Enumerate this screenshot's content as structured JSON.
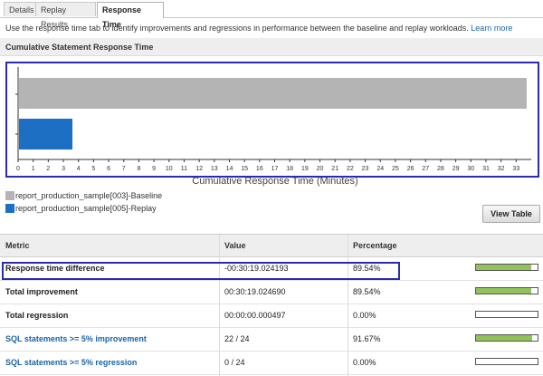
{
  "tabs": [
    {
      "label": "Details",
      "active": false
    },
    {
      "label": "Replay Results",
      "active": false
    },
    {
      "label": "Response Time",
      "active": true
    }
  ],
  "intro": {
    "text": "Use the response time tab to identify improvements and regressions in performance between the baseline and replay workloads.",
    "link": "Learn more"
  },
  "chart_section": {
    "title": "Cumulative Statement Response Time"
  },
  "chart_data": {
    "type": "bar",
    "orientation": "horizontal",
    "categories": [
      "report_production_sample[003]-Baseline",
      "report_production_sample[005]-Replay"
    ],
    "values": [
      33.7,
      3.6
    ],
    "colors": [
      "#b4b4b4",
      "#1d6fc4"
    ],
    "xlabel": "Cumulative Response Time (Minutes)",
    "ylabel": "",
    "xlim": [
      0,
      34
    ],
    "xticks": [
      0,
      1,
      2,
      3,
      4,
      5,
      6,
      7,
      8,
      9,
      10,
      11,
      12,
      13,
      14,
      15,
      16,
      17,
      18,
      19,
      20,
      21,
      22,
      23,
      24,
      25,
      26,
      27,
      28,
      29,
      30,
      31,
      32,
      33
    ],
    "legend": "bottom-left"
  },
  "legend": [
    {
      "label": "report_production_sample[003]-Baseline",
      "color": "#b4b4b4"
    },
    {
      "label": "report_production_sample[005]-Replay",
      "color": "#1d6fc4"
    }
  ],
  "view_table_label": "View Table",
  "table": {
    "headers": {
      "metric": "Metric",
      "value": "Value",
      "percentage": "Percentage"
    },
    "rows": [
      {
        "metric": "Response time difference",
        "value": "-00:30:19.024193",
        "percentage": "89.54%",
        "fill": 0.8954,
        "link": false
      },
      {
        "metric": "Total improvement",
        "value": "00:30:19.024690",
        "percentage": "89.54%",
        "fill": 0.8954,
        "link": false
      },
      {
        "metric": "Total regression",
        "value": "00:00:00.000497",
        "percentage": "0.00%",
        "fill": 0,
        "link": false
      },
      {
        "metric": "SQL statements >= 5% improvement",
        "value": "22 / 24",
        "percentage": "91.67%",
        "fill": 0.9167,
        "link": true
      },
      {
        "metric": "SQL statements >= 5% regression",
        "value": "0 / 24",
        "percentage": "0.00%",
        "fill": 0,
        "link": true
      }
    ]
  }
}
